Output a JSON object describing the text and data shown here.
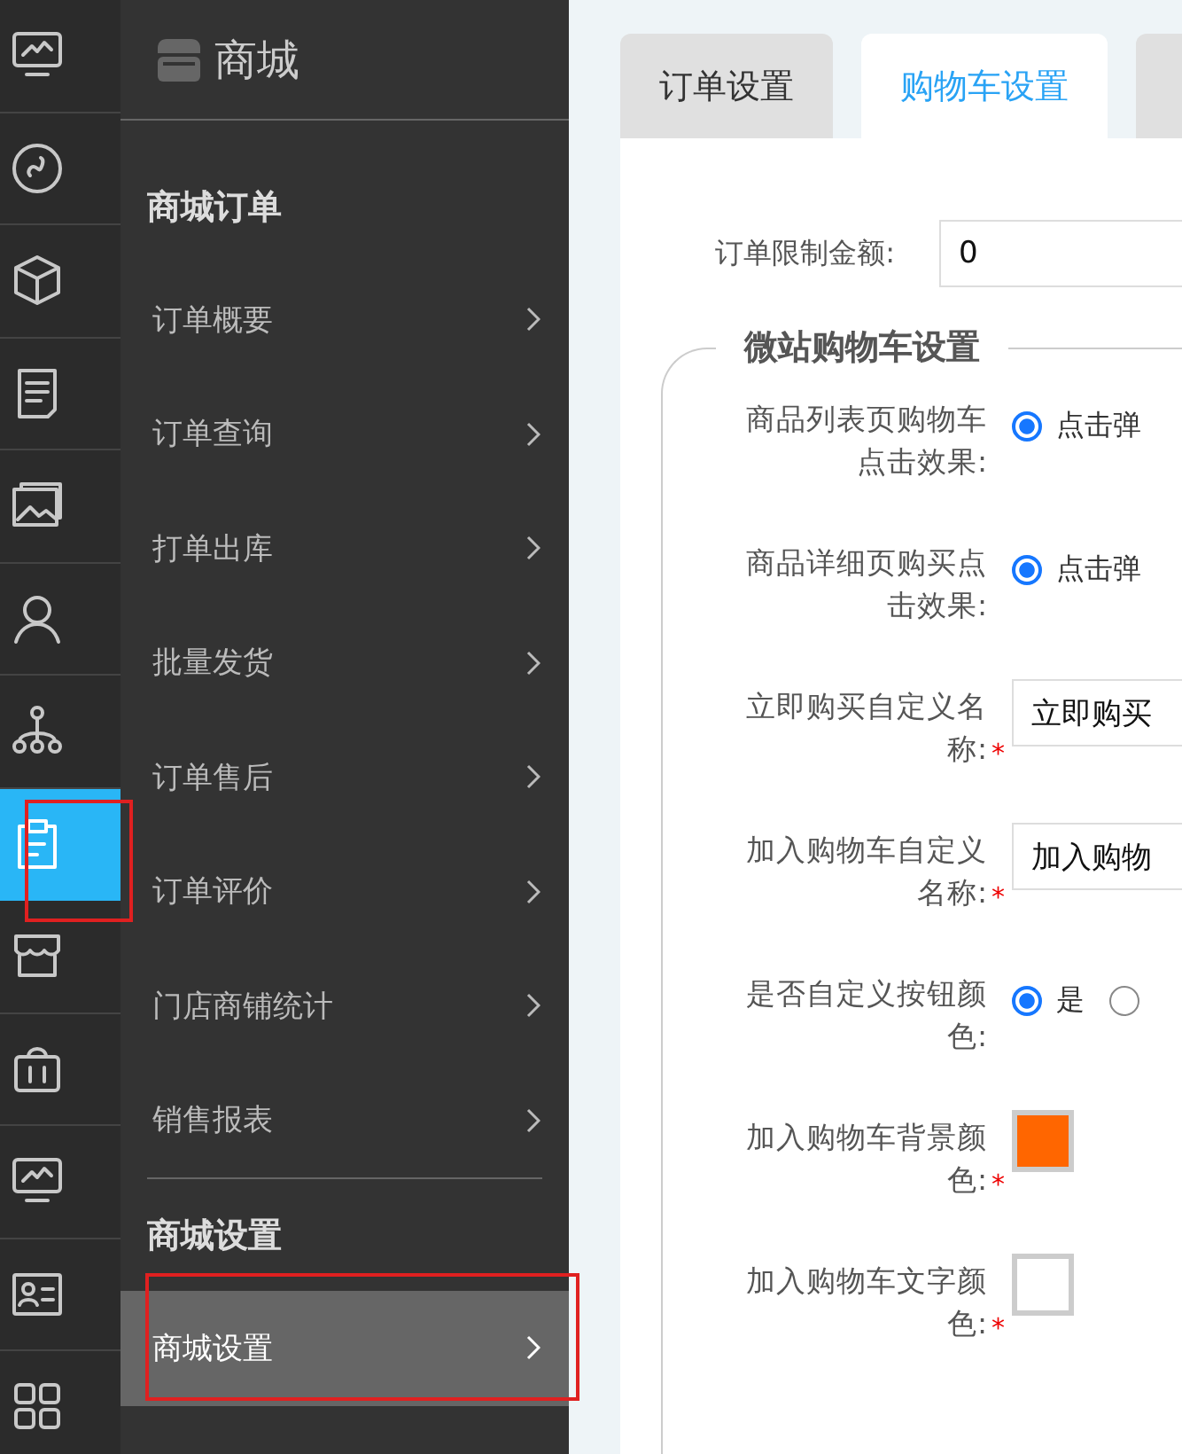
{
  "rail": {
    "items": [
      {
        "kind": "monitor",
        "selected": false,
        "annotated": false
      },
      {
        "kind": "link",
        "selected": false,
        "annotated": false
      },
      {
        "kind": "cube",
        "selected": false,
        "annotated": false
      },
      {
        "kind": "document",
        "selected": false,
        "annotated": false
      },
      {
        "kind": "picture",
        "selected": false,
        "annotated": false
      },
      {
        "kind": "person",
        "selected": false,
        "annotated": false
      },
      {
        "kind": "hierarchy",
        "selected": false,
        "annotated": false
      },
      {
        "kind": "clipboard",
        "selected": true,
        "annotated": true
      },
      {
        "kind": "store",
        "selected": false,
        "annotated": false
      },
      {
        "kind": "bag",
        "selected": false,
        "annotated": false
      },
      {
        "kind": "monitor",
        "selected": false,
        "annotated": false
      },
      {
        "kind": "card",
        "selected": false,
        "annotated": false
      },
      {
        "kind": "grid",
        "selected": false,
        "annotated": false
      }
    ]
  },
  "menu": {
    "title": "商城",
    "sections": [
      {
        "heading": "商城订单",
        "items": [
          {
            "label": "订单概要",
            "selected": false,
            "annotated": false
          },
          {
            "label": "订单查询",
            "selected": false,
            "annotated": false
          },
          {
            "label": "打单出库",
            "selected": false,
            "annotated": false
          },
          {
            "label": "批量发货",
            "selected": false,
            "annotated": false
          },
          {
            "label": "订单售后",
            "selected": false,
            "annotated": false
          },
          {
            "label": "订单评价",
            "selected": false,
            "annotated": false
          },
          {
            "label": "门店商铺统计",
            "selected": false,
            "annotated": false
          },
          {
            "label": "销售报表",
            "selected": false,
            "annotated": false
          }
        ]
      },
      {
        "heading": "商城设置",
        "items": [
          {
            "label": "商城设置",
            "selected": true,
            "annotated": true
          }
        ]
      }
    ]
  },
  "tabs": [
    {
      "label": "订单设置",
      "selected": false
    },
    {
      "label": "购物车设置",
      "selected": true
    },
    {
      "selected": false
    }
  ],
  "order_limit": {
    "label": "订单限制金额:",
    "value": "0"
  },
  "fieldset": {
    "legend": "微站购物车设置",
    "rows": [
      {
        "kind": "radio",
        "label": "商品列表页购物车点击效果:",
        "options": [
          {
            "label": "点击弹",
            "selected": true
          }
        ]
      },
      {
        "kind": "radio",
        "label": "商品详细页购买点击效果:",
        "options": [
          {
            "label": "点击弹",
            "selected": true
          }
        ]
      },
      {
        "kind": "text",
        "label": "立即购买自定义名称:",
        "required_mark": "*",
        "value": "立即购买"
      },
      {
        "kind": "text",
        "label": "加入购物车自定义名称:",
        "required_mark": "*",
        "value": "加入购物"
      },
      {
        "kind": "radio",
        "label": "是否自定义按钮颜色:",
        "options": [
          {
            "label": "是",
            "selected": true
          },
          {
            "selected": false
          }
        ]
      },
      {
        "kind": "color",
        "label": "加入购物车背景颜色:",
        "required_mark": "*",
        "color": "#ff6600"
      },
      {
        "kind": "color",
        "label": "加入购物车文字颜色:",
        "required_mark": "*",
        "color": "#ffffff"
      }
    ]
  }
}
